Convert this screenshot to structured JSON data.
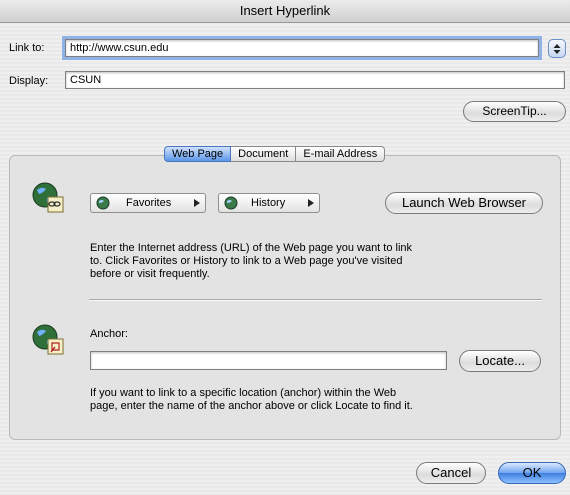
{
  "window": {
    "title": "Insert Hyperlink"
  },
  "link_to": {
    "label": "Link to:",
    "value": "http://www.csun.edu"
  },
  "display": {
    "label": "Display:",
    "value": "CSUN"
  },
  "buttons": {
    "screentip": "ScreenTip...",
    "launch_browser": "Launch Web Browser",
    "locate": "Locate...",
    "cancel": "Cancel",
    "ok": "OK"
  },
  "tabs": [
    "Web Page",
    "Document",
    "E-mail Address"
  ],
  "active_tab": "Web Page",
  "web_page": {
    "favorites_label": "Favorites",
    "history_label": "History",
    "instructions": [
      "Enter the Internet address (URL) of the Web page you want to link",
      "to. Click Favorites or History to link to a Web page you've visited",
      "before or visit frequently."
    ]
  },
  "anchor": {
    "label": "Anchor:",
    "value": "",
    "instructions": [
      "If you want to link to a specific location (anchor) within the Web",
      "page, enter the name of the anchor above or click Locate to find it."
    ]
  },
  "colors": {
    "accent": "#3d7fe0",
    "panel": "#e3e3e3"
  }
}
